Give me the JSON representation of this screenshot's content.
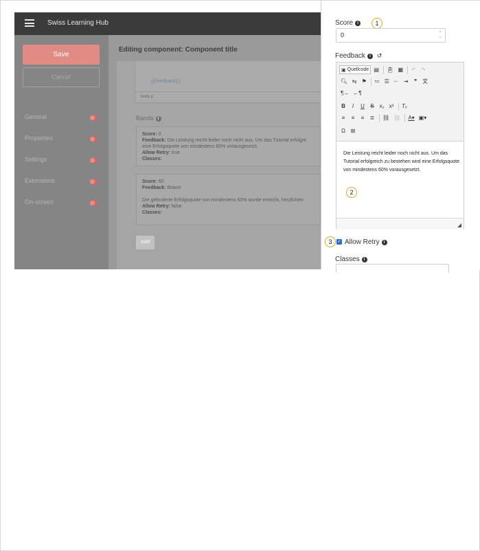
{
  "app": {
    "brand": "Swiss Learning Hub",
    "save_label": "Save",
    "cancel_label": "Cancel",
    "nav": [
      {
        "label": "General"
      },
      {
        "label": "Properties"
      },
      {
        "label": "Settings"
      },
      {
        "label": "Extensions"
      },
      {
        "label": "On-screen"
      }
    ],
    "title": "Editing component: Component title",
    "editor_tag": "{{{feedback}}}",
    "editor_path": "body  p",
    "bands_heading": "Bands",
    "bands": [
      {
        "score_label": "Score:",
        "score": "0",
        "feedback_label": "Feedback:",
        "feedback_line1": "Die Leistung reicht leider noch nicht aus. Um das Tutorial erfolgre",
        "feedback_line2": "eine Erfolgsquote von mindestens 60% vorausgesetzt.",
        "retry_label": "Allow Retry:",
        "retry": "true",
        "classes_label": "Classes:"
      },
      {
        "score_label": "Score:",
        "score": "60",
        "feedback_label": "Feedback:",
        "feedback": "Bravo!",
        "extra": "Die geforderte Erfolgsquote von mindestens 60% wurde erreicht, herzlichen",
        "retry_label": "Allow Retry:",
        "retry": "false",
        "classes_label": "Classes:"
      }
    ],
    "add_label": "Add"
  },
  "panel": {
    "score_label": "Score",
    "score_value": "0",
    "feedback_label": "Feedback",
    "toolbar": {
      "source_label": "Quellcode"
    },
    "editor_text": "Die Leistung reicht leider noch nicht aus. Um das Tutorial erfolgreich zu bestehen wird eine Erfolgsquote von mindestens 60% vorausgesetzt.",
    "allow_retry_label": "Allow Retry",
    "allow_retry_checked": true,
    "classes_label": "Classes"
  },
  "callouts": [
    "1",
    "2",
    "3"
  ],
  "colors": {
    "save_button": "#e28a84",
    "toggle_on": "#e2625b",
    "callout_ring": "#e3a81a",
    "checkbox": "#2f6fd0"
  }
}
